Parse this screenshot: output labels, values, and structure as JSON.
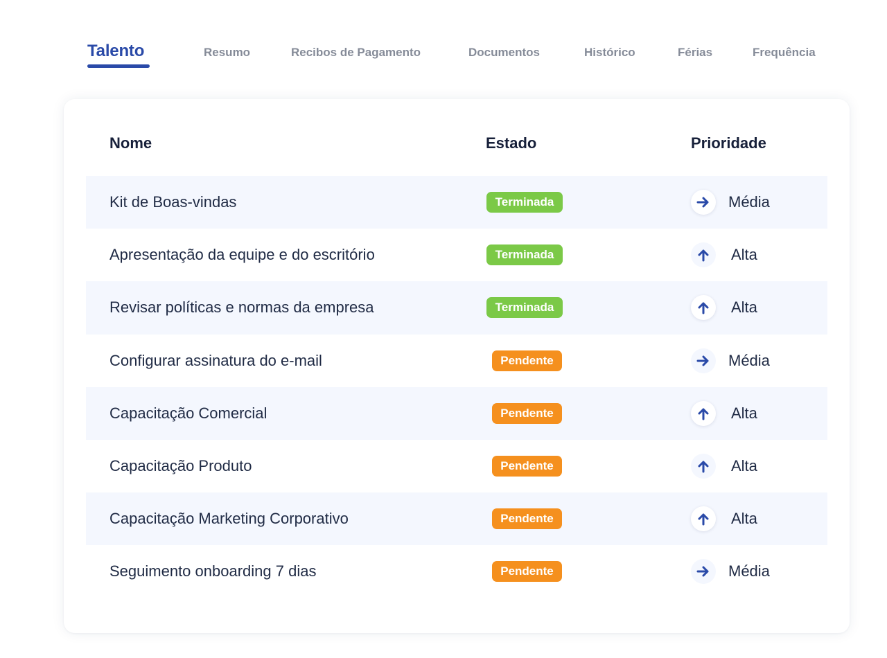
{
  "tabs": [
    {
      "label": "Talento",
      "active": true
    },
    {
      "label": "Resumo",
      "active": false
    },
    {
      "label": "Recibos de Pagamento",
      "active": false
    },
    {
      "label": "Documentos",
      "active": false
    },
    {
      "label": "Histórico",
      "active": false
    },
    {
      "label": "Férias",
      "active": false
    },
    {
      "label": "Frequência",
      "active": false
    }
  ],
  "table": {
    "headers": {
      "nome": "Nome",
      "estado": "Estado",
      "prioridade": "Prioridade"
    },
    "rows": [
      {
        "nome": "Kit de Boas-vindas",
        "estado": "Terminada",
        "prioridade": "Média",
        "prio_icon": "arrow-right-icon"
      },
      {
        "nome": "Apresentação da equipe e do escritório",
        "estado": "Terminada",
        "prioridade": "Alta",
        "prio_icon": "arrow-up-icon"
      },
      {
        "nome": "Revisar políticas e normas da empresa",
        "estado": "Terminada",
        "prioridade": "Alta",
        "prio_icon": "arrow-up-icon"
      },
      {
        "nome": "Configurar assinatura do e-mail",
        "estado": "Pendente",
        "prioridade": "Média",
        "prio_icon": "arrow-right-icon"
      },
      {
        "nome": "Capacitação Comercial",
        "estado": "Pendente",
        "prioridade": "Alta",
        "prio_icon": "arrow-up-icon"
      },
      {
        "nome": "Capacitação Produto",
        "estado": "Pendente",
        "prioridade": "Alta",
        "prio_icon": "arrow-up-icon"
      },
      {
        "nome": "Capacitação Marketing Corporativo",
        "estado": "Pendente",
        "prioridade": "Alta",
        "prio_icon": "arrow-up-icon"
      },
      {
        "nome": "Seguimento onboarding 7 dias",
        "estado": "Pendente",
        "prioridade": "Média",
        "prio_icon": "arrow-right-icon"
      }
    ]
  },
  "colors": {
    "accent": "#2a4aa8",
    "status_done": "#7bc947",
    "status_pending": "#f5901e",
    "row_stripe": "#f4f7fe"
  }
}
